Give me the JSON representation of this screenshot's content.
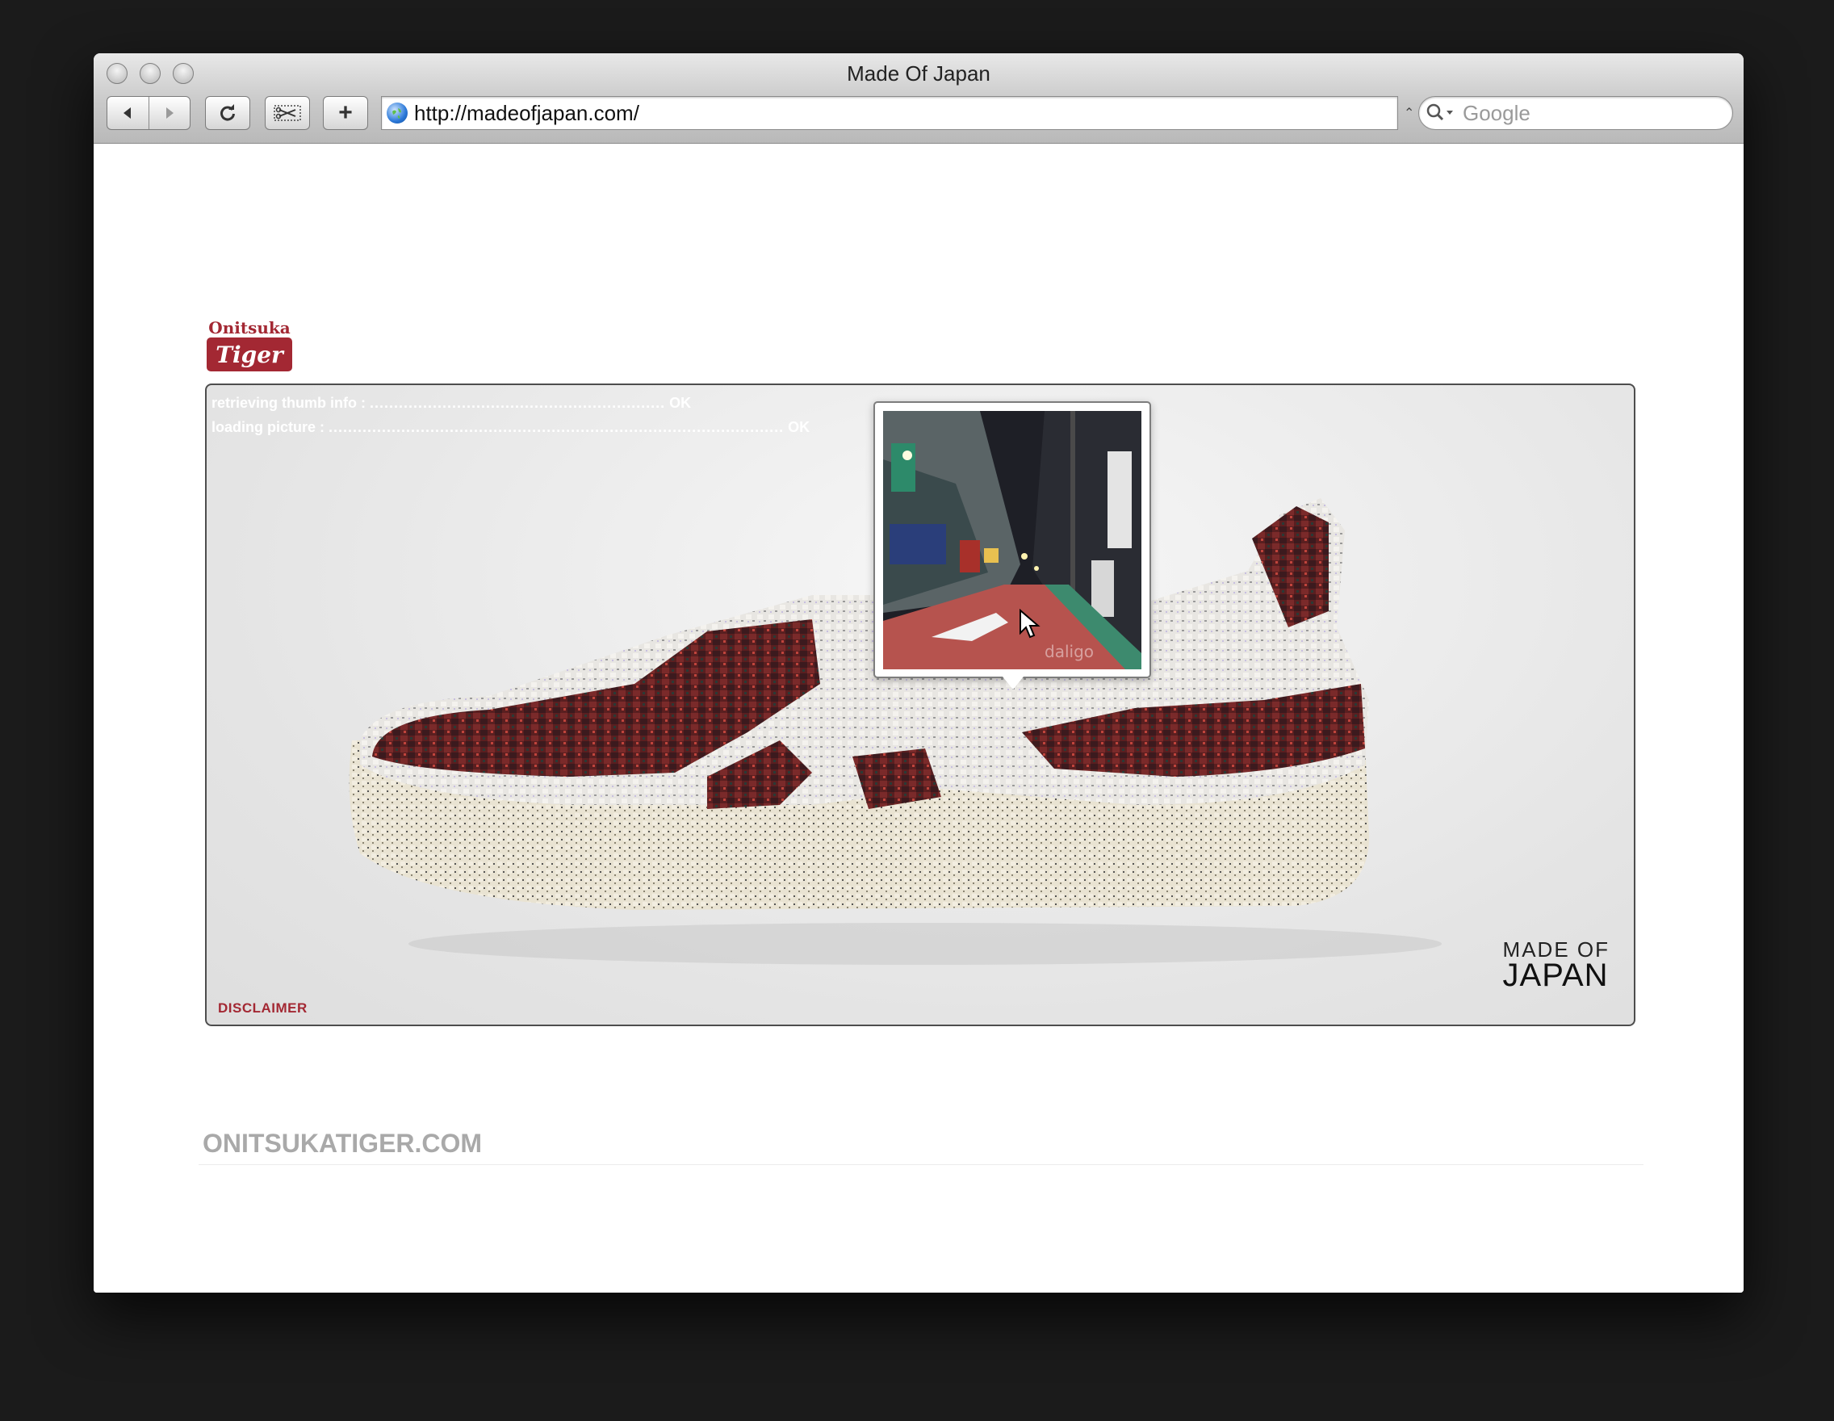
{
  "window": {
    "title": "Made Of Japan"
  },
  "toolbar": {
    "address": "http://madeofjapan.com/",
    "search_placeholder": "Google",
    "add_label": "+"
  },
  "logo": {
    "top_text": "Onitsuka",
    "badge_text": "Tiger"
  },
  "stage": {
    "status_lines": [
      {
        "label": "retrieving thumb info :",
        "result": "OK"
      },
      {
        "label": "loading picture :",
        "result": "OK"
      }
    ],
    "disclaimer": "DISCLAIMER",
    "brand_line1": "MADE OF",
    "brand_line2": "JAPAN"
  },
  "footer": {
    "link": "ONITSUKATIGER.COM"
  },
  "colors": {
    "brand_red": "#a32833",
    "footer_gray": "#a9a9a9"
  },
  "icons": [
    "back-arrow-icon",
    "forward-arrow-icon",
    "reload-icon",
    "snapback-icon",
    "plus-icon",
    "globe-icon",
    "search-icon",
    "cursor-icon"
  ]
}
